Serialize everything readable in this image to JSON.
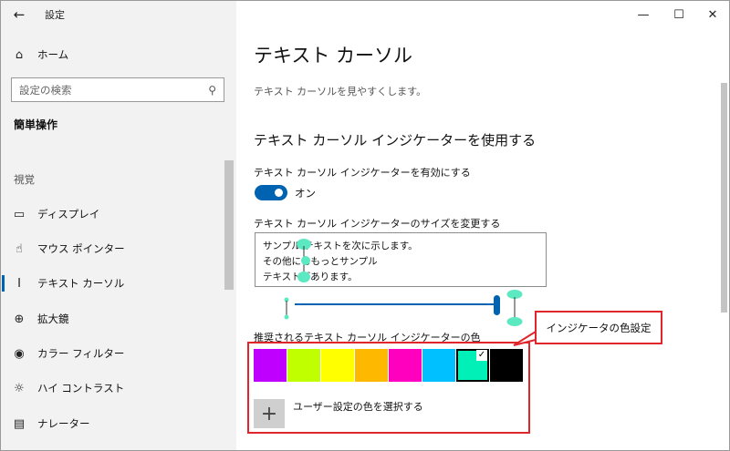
{
  "app": {
    "title": "設定",
    "back_icon": "←"
  },
  "window_controls": {
    "minimize": "—",
    "maximize": "☐",
    "close": "✕"
  },
  "sidebar": {
    "home": {
      "icon": "⌂",
      "label": "ホーム"
    },
    "search": {
      "placeholder": "設定の検索",
      "icon": "⚲"
    },
    "category": "簡単操作",
    "section": "視覚",
    "items": [
      {
        "icon": "▭",
        "label": "ディスプレイ"
      },
      {
        "icon": "☝",
        "label": "マウス ポインター"
      },
      {
        "icon": "I",
        "label": "テキスト カーソル"
      },
      {
        "icon": "⊕",
        "label": "拡大鏡"
      },
      {
        "icon": "◉",
        "label": "カラー フィルター"
      },
      {
        "icon": "☼",
        "label": "ハイ コントラスト"
      },
      {
        "icon": "▤",
        "label": "ナレーター"
      }
    ]
  },
  "main": {
    "title": "テキスト カーソル",
    "description": "テキスト カーソルを見やすくします。",
    "subheading": "テキスト カーソル インジケーターを使用する",
    "enable_label": "テキスト カーソル インジケーターを有効にする",
    "toggle_state": "オン",
    "toggle_on": true,
    "size_label": "テキスト カーソル インジケーターのサイズを変更する",
    "preview_lines": [
      "サンプル テキストを次に示します。",
      "その他にももっとサンプル",
      "テキストがあります。"
    ],
    "slider_level": 0.99,
    "color_label": "推奨されるテキスト カーソル インジケーターの色",
    "colors": [
      "#bf00ff",
      "#bfff00",
      "#ffff00",
      "#ffb800",
      "#ff00bf",
      "#00c0ff",
      "#00f0b8",
      "#000000"
    ],
    "selected_color_index": 6,
    "check_icon": "✓",
    "custom_plus": "+",
    "custom_color_label": "ユーザー設定の色を選択する",
    "indicator_color": "#5ce8c0",
    "accent_color": "#0063b1"
  },
  "annotation": {
    "callout_text": "インジケータの色設定",
    "border_color": "#e0262a"
  }
}
